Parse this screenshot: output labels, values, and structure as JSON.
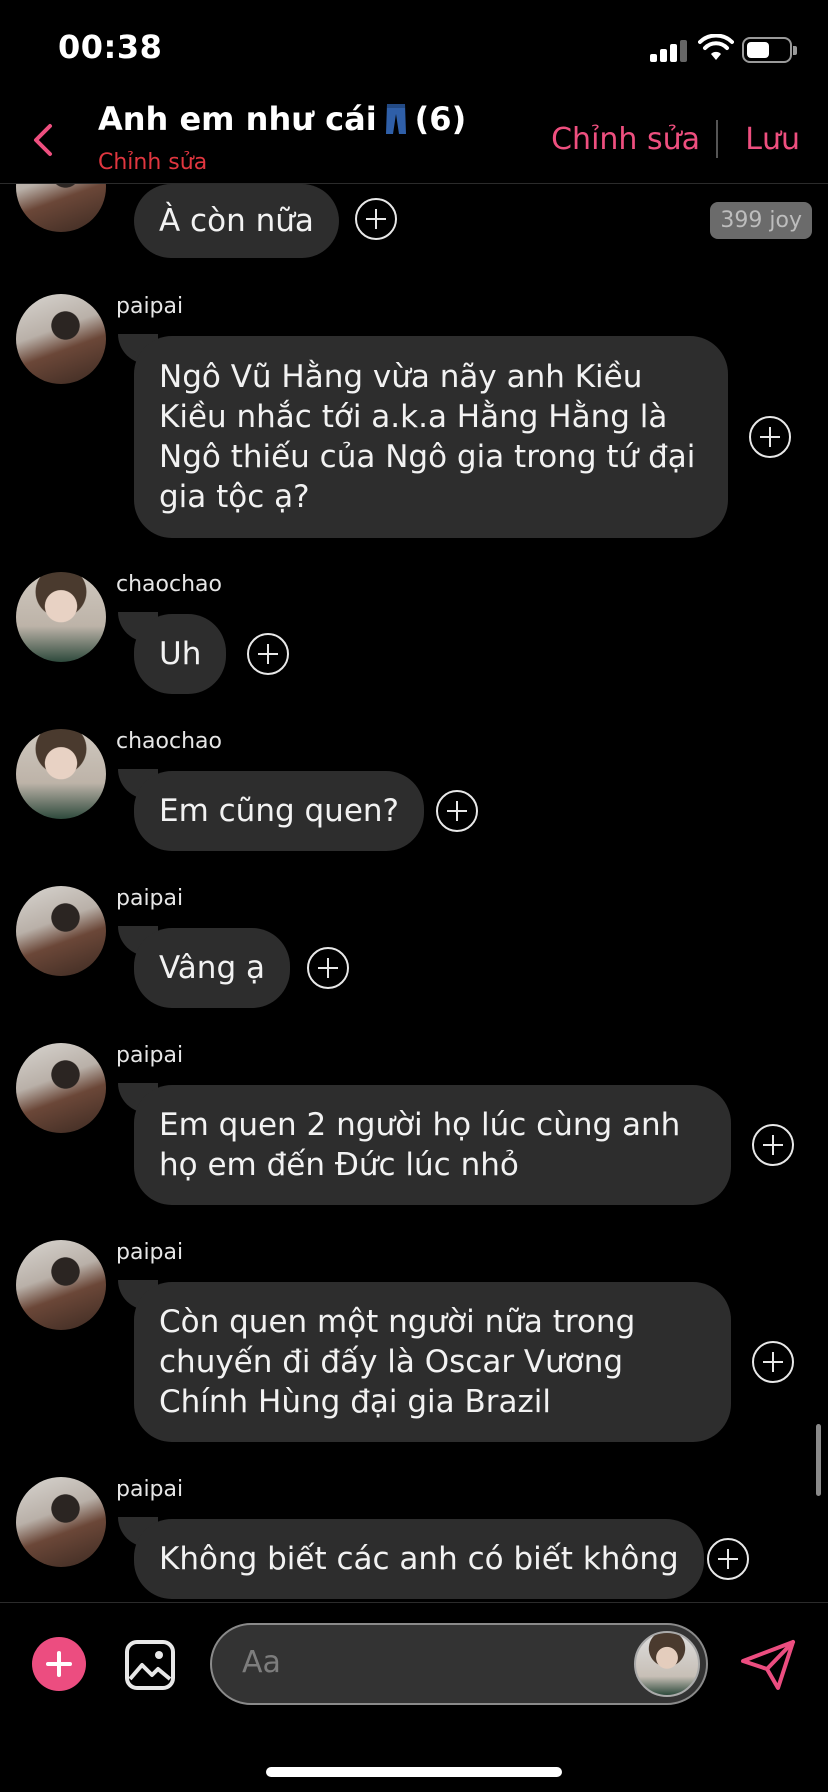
{
  "status_bar": {
    "time": "00:38"
  },
  "header": {
    "title": "Anh em như cái",
    "title_emoji": "jeans-icon",
    "title_count": "(6)",
    "subtitle": "Chỉnh sửa",
    "edit_label": "Chỉnh sửa",
    "save_label": "Lưu"
  },
  "badge": {
    "text": "399 joy"
  },
  "messages": [
    {
      "sender": "",
      "text": "À còn nữa"
    },
    {
      "sender": "paipai",
      "text": "Ngô Vũ Hằng vừa nãy anh Kiều Kiều nhắc tới a.k.a Hằng Hằng là Ngô thiếu của Ngô gia trong tứ đại gia tộc ạ?"
    },
    {
      "sender": "chaochao",
      "text": "Uh"
    },
    {
      "sender": "chaochao",
      "text": "Em cũng quen?"
    },
    {
      "sender": "paipai",
      "text": "Vâng ạ"
    },
    {
      "sender": "paipai",
      "text": "Em quen 2 người họ lúc cùng anh họ em đến Đức lúc nhỏ"
    },
    {
      "sender": "paipai",
      "text": "Còn quen một người nữa trong chuyến đi đấy là Oscar Vương Chính Hùng đại gia Brazil"
    },
    {
      "sender": "paipai",
      "text": "Không biết các anh có biết không"
    }
  ],
  "input": {
    "placeholder": "Aa"
  },
  "colors": {
    "accent": "#ec4d80",
    "bubble": "#2d2d2d",
    "subtitle_red": "#e0363f"
  }
}
